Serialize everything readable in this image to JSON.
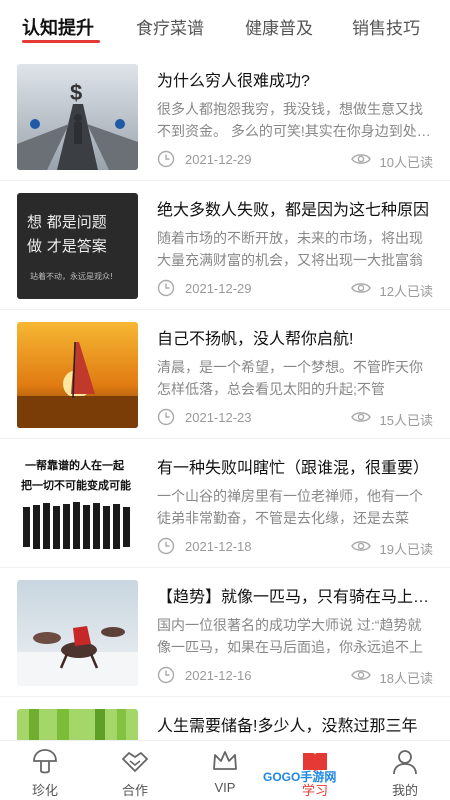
{
  "tabs": [
    {
      "label": "认知提升",
      "active": true
    },
    {
      "label": "食疗菜谱",
      "active": false
    },
    {
      "label": "健康普及",
      "active": false
    },
    {
      "label": "销售技巧",
      "active": false
    }
  ],
  "articles": [
    {
      "title": "为什么穷人很难成功?",
      "desc": "很多人都抱怨我穷，我没钱，想做生意又找不到资金。 多么的可笑!其实在你身边到处都是钱",
      "date": "2021-12-29",
      "views": "10人已读",
      "thumb_caption": ""
    },
    {
      "title": "绝大多数人失败，都是因为这七种原因",
      "desc": "随着市场的不断开放，未来的市场，将出现大量充满财富的机会，又将出现一大批富翁",
      "date": "2021-12-29",
      "views": "12人已读",
      "thumb_caption_1": "想  都是问题",
      "thumb_caption_2": "做  才是答案",
      "thumb_caption_3": "站着不动，永远是观众!"
    },
    {
      "title": "自己不扬帆，没人帮你启航!",
      "desc": "清晨，是一个希望，一个梦想。不管昨天你怎样低落，总会看见太阳的升起;不管",
      "date": "2021-12-23",
      "views": "15人已读"
    },
    {
      "title": "有一种失败叫瞎忙（跟谁混，很重要）",
      "desc": "一个山谷的禅房里有一位老禅师，他有一个徒弟非常勤奋，不管是去化缘，还是去菜",
      "date": "2021-12-18",
      "views": "19人已读",
      "thumb_caption_1": "一帮靠谱的人在一起",
      "thumb_caption_2": "把一切不可能变成可能"
    },
    {
      "title": "【趋势】就像一匹马，只有骑在马上才能前进",
      "desc": "国内一位很著名的成功学大师说 过:“趋势就像一匹马，如果在马后面追，你永远追不上",
      "date": "2021-12-16",
      "views": "18人已读"
    },
    {
      "title": "人生需要储备!多少人，没熬过那三年",
      "desc": "",
      "date": "",
      "views": ""
    }
  ],
  "bottom_nav": [
    {
      "label": "珍化",
      "icon": "mushroom-icon",
      "active": false
    },
    {
      "label": "合作",
      "icon": "handshake-icon",
      "active": false
    },
    {
      "label": "VIP",
      "icon": "crown-icon",
      "active": false
    },
    {
      "label": "学习",
      "icon": "book-icon",
      "active": true
    },
    {
      "label": "我的",
      "icon": "user-icon",
      "active": false
    }
  ],
  "watermark": "GOGO手游网",
  "colors": {
    "accent": "#e53935",
    "text": "#111111",
    "muted": "#888888"
  }
}
